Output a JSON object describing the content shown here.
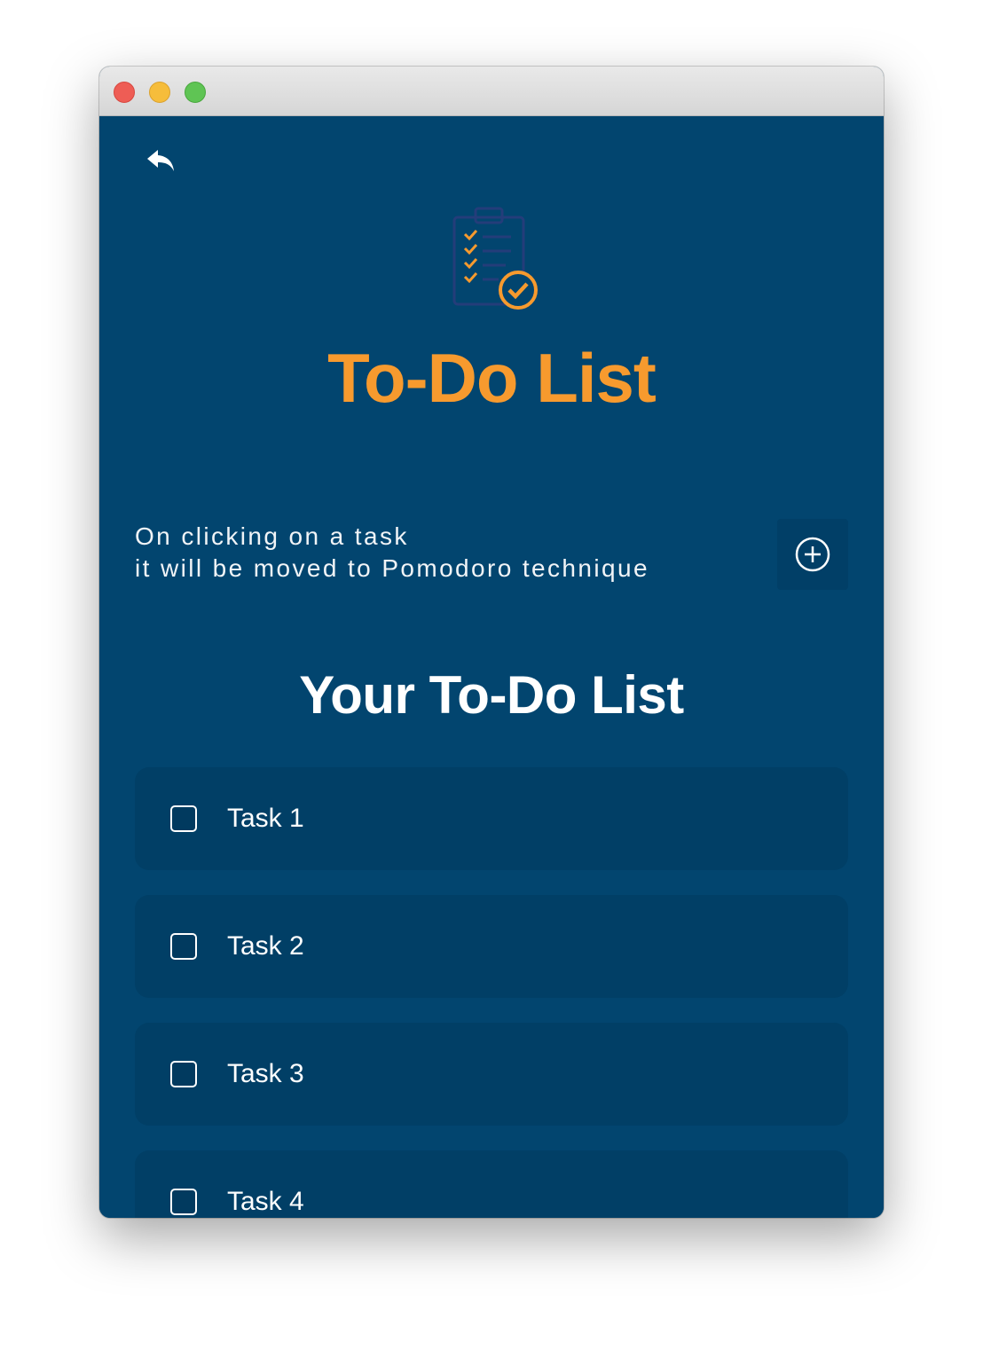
{
  "window": {
    "controls": [
      "close",
      "minimize",
      "maximize"
    ]
  },
  "header": {
    "back_icon": "reply-arrow-icon",
    "logo_icon": "clipboard-checklist-icon",
    "title": "To-Do List"
  },
  "hint": {
    "line1": "On clicking on a task",
    "line2": "it will be moved to Pomodoro technique"
  },
  "add_button": {
    "icon": "plus-circle-icon"
  },
  "list": {
    "title": "Your To-Do List",
    "tasks": [
      {
        "label": "Task 1",
        "checked": false
      },
      {
        "label": "Task 2",
        "checked": false
      },
      {
        "label": "Task 3",
        "checked": false
      },
      {
        "label": "Task 4",
        "checked": false
      }
    ]
  },
  "colors": {
    "background": "#02456f",
    "card": "#013f66",
    "accent": "#f79a2e",
    "text": "#ffffff"
  }
}
